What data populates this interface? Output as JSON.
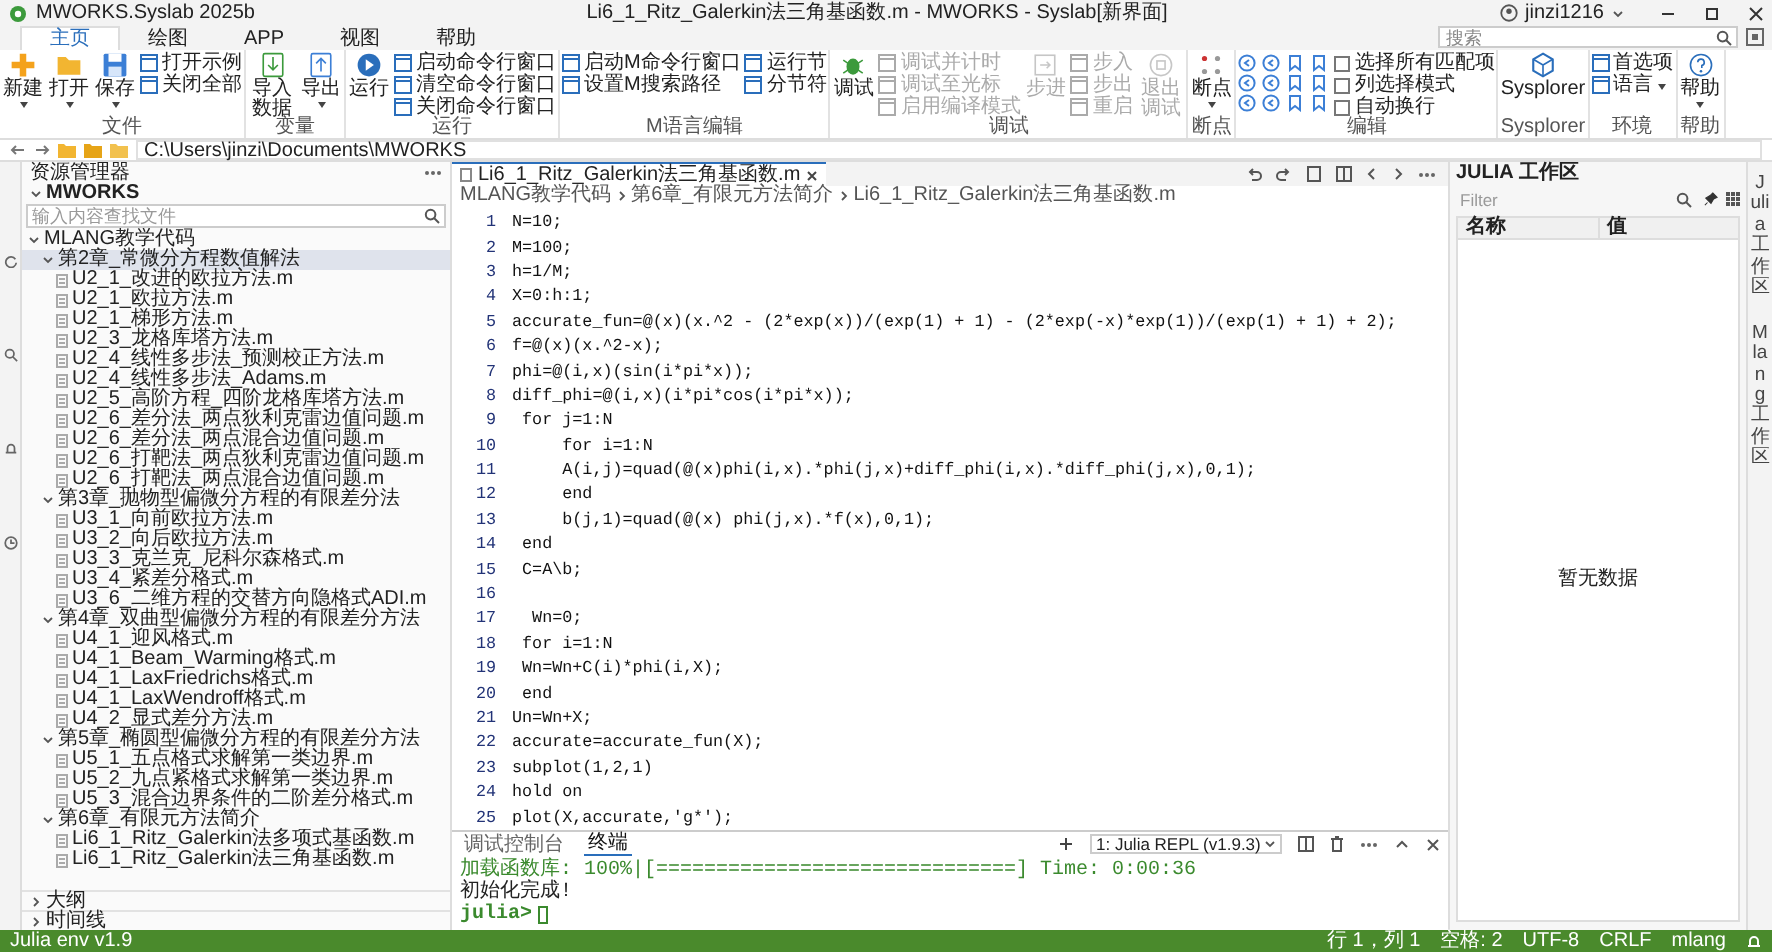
{
  "window": {
    "app_name": "MWORKS.Syslab 2025b",
    "title": "Li6_1_Ritz_Galerkin法三角基函数.m - MWORKS - Syslab[新界面]",
    "user": "jinzi1216"
  },
  "menu_tabs": [
    {
      "label": "主页",
      "selected": true
    },
    {
      "label": "绘图",
      "selected": false
    },
    {
      "label": "APP",
      "selected": false
    },
    {
      "label": "视图",
      "selected": false
    },
    {
      "label": "帮助",
      "selected": false
    }
  ],
  "search": {
    "placeholder": "搜索"
  },
  "ribbon": [
    {
      "label": "文件",
      "items": [
        {
          "kind": "large",
          "label": "新建",
          "dropdown": true,
          "disabled": false
        },
        {
          "kind": "large",
          "label": "打开",
          "dropdown": true,
          "disabled": false
        },
        {
          "kind": "large",
          "label": "保存",
          "dropdown": true,
          "disabled": false
        },
        {
          "kind": "stack",
          "items": [
            {
              "label": "打开示例",
              "dropdown": false,
              "disabled": false
            },
            {
              "label": "关闭全部",
              "dropdown": false,
              "disabled": false
            }
          ]
        }
      ]
    },
    {
      "label": "变量",
      "items": [
        {
          "kind": "large",
          "label": "导入数据",
          "dropdown": false,
          "disabled": false
        },
        {
          "kind": "large",
          "label": "导出",
          "dropdown": true,
          "disabled": false
        }
      ]
    },
    {
      "label": "运行",
      "items": [
        {
          "kind": "large",
          "label": "运行",
          "dropdown": false,
          "disabled": false
        },
        {
          "kind": "stack",
          "items": [
            {
              "label": "启动命令行窗口",
              "dropdown": false,
              "disabled": false
            },
            {
              "label": "清空命令行窗口",
              "dropdown": false,
              "disabled": false
            },
            {
              "label": "关闭命令行窗口",
              "dropdown": false,
              "disabled": false
            }
          ]
        }
      ]
    },
    {
      "label": "M语言编辑",
      "items": [
        {
          "kind": "stack",
          "items": [
            {
              "label": "启动M命令行窗口",
              "dropdown": false,
              "disabled": false
            },
            {
              "label": "设置M搜索路径",
              "dropdown": false,
              "disabled": false
            }
          ]
        },
        {
          "kind": "stack",
          "items": [
            {
              "label": "运行节",
              "dropdown": false,
              "disabled": false
            },
            {
              "label": "分节符",
              "dropdown": false,
              "disabled": false
            }
          ]
        }
      ]
    },
    {
      "label": "调试",
      "items": [
        {
          "kind": "large",
          "label": "调试",
          "dropdown": false,
          "disabled": false
        },
        {
          "kind": "stack",
          "items": [
            {
              "label": "调试并计时",
              "dropdown": false,
              "disabled": true
            },
            {
              "label": "调试至光标",
              "dropdown": false,
              "disabled": true
            },
            {
              "label": "启用编译模式",
              "dropdown": false,
              "disabled": true
            }
          ]
        },
        {
          "kind": "large",
          "label": "步进",
          "dropdown": false,
          "disabled": true
        },
        {
          "kind": "stack",
          "items": [
            {
              "label": "步入",
              "dropdown": false,
              "disabled": true
            },
            {
              "label": "步出",
              "dropdown": false,
              "disabled": true
            },
            {
              "label": "重启",
              "dropdown": false,
              "disabled": true
            }
          ]
        },
        {
          "kind": "large",
          "label": "退出调试",
          "dropdown": false,
          "disabled": true
        }
      ]
    },
    {
      "label": "断点",
      "items": [
        {
          "kind": "large",
          "label": "断点",
          "dropdown": true,
          "disabled": false
        }
      ]
    },
    {
      "label": "编辑",
      "items": [
        {
          "kind": "tools"
        },
        {
          "kind": "checks",
          "items": [
            {
              "label": "选择所有匹配项",
              "checked": false
            },
            {
              "label": "列选择模式",
              "checked": false
            },
            {
              "label": "自动换行",
              "checked": false
            }
          ]
        }
      ]
    },
    {
      "label": "Sysplorer",
      "items": [
        {
          "kind": "large",
          "label": "Sysplorer",
          "dropdown": false,
          "disabled": false
        }
      ]
    },
    {
      "label": "环境",
      "items": [
        {
          "kind": "stack",
          "items": [
            {
              "label": "首选项",
              "dropdown": false,
              "disabled": false
            },
            {
              "label": "语言",
              "dropdown": true,
              "disabled": false
            }
          ]
        }
      ]
    },
    {
      "label": "帮助",
      "items": [
        {
          "kind": "large",
          "label": "帮助",
          "dropdown": true,
          "disabled": false
        }
      ]
    }
  ],
  "path_bar": {
    "path": "C:\\Users\\jinzi\\Documents\\MWORKS"
  },
  "sidebar": {
    "title": "资源管理器",
    "root": "MWORKS",
    "search": {
      "placeholder": "输入内容查找文件"
    },
    "tree": [
      {
        "label": "MLANG教学代码",
        "expanded": true,
        "selected": false,
        "children": [
          {
            "label": "第2章_常微分方程数值解法",
            "expanded": true,
            "selected": true,
            "children": [
              {
                "label": "U2_1_改进的欧拉方法.m",
                "selected": false
              },
              {
                "label": "U2_1_欧拉方法.m",
                "selected": false
              },
              {
                "label": "U2_1_梯形方法.m",
                "selected": false
              },
              {
                "label": "U2_3_龙格库塔方法.m",
                "selected": false
              },
              {
                "label": "U2_4_线性多步法_预测校正方法.m",
                "selected": false
              },
              {
                "label": "U2_4_线性多步法_Adams.m",
                "selected": false
              },
              {
                "label": "U2_5_高阶方程_四阶龙格库塔方法.m",
                "selected": false
              },
              {
                "label": "U2_6_差分法_两点狄利克雷边值问题.m",
                "selected": false
              },
              {
                "label": "U2_6_差分法_两点混合边值问题.m",
                "selected": false
              },
              {
                "label": "U2_6_打靶法_两点狄利克雷边值问题.m",
                "selected": false
              },
              {
                "label": "U2_6_打靶法_两点混合边值问题.m",
                "selected": false
              }
            ]
          },
          {
            "label": "第3章_抛物型偏微分方程的有限差分法",
            "expanded": true,
            "selected": false,
            "children": [
              {
                "label": "U3_1_向前欧拉方法.m",
                "selected": false
              },
              {
                "label": "U3_2_向后欧拉方法.m",
                "selected": false
              },
              {
                "label": "U3_3_克兰克_尼科尔森格式.m",
                "selected": false
              },
              {
                "label": "U3_4_紧差分格式.m",
                "selected": false
              },
              {
                "label": "U3_6_二维方程的交替方向隐格式ADI.m",
                "selected": false
              }
            ]
          },
          {
            "label": "第4章_双曲型偏微分方程的有限差分方法",
            "expanded": true,
            "selected": false,
            "children": [
              {
                "label": "U4_1_迎风格式.m",
                "selected": false
              },
              {
                "label": "U4_1_Beam_Warming格式.m",
                "selected": false
              },
              {
                "label": "U4_1_LaxFriedrichs格式.m",
                "selected": false
              },
              {
                "label": "U4_1_LaxWendroff格式.m",
                "selected": false
              },
              {
                "label": "U4_2_显式差分方法.m",
                "selected": false
              }
            ]
          },
          {
            "label": "第5章_椭圆型偏微分方程的有限差分方法",
            "expanded": true,
            "selected": false,
            "children": [
              {
                "label": "U5_1_五点格式求解第一类边界.m",
                "selected": false
              },
              {
                "label": "U5_2_九点紧格式求解第一类边界.m",
                "selected": false
              },
              {
                "label": "U5_3_混合边界条件的二阶差分格式.m",
                "selected": false
              }
            ]
          },
          {
            "label": "第6章_有限元方法简介",
            "expanded": true,
            "selected": false,
            "children": [
              {
                "label": "Li6_1_Ritz_Galerkin法多项式基函数.m",
                "selected": false
              },
              {
                "label": "Li6_1_Ritz_Galerkin法三角基函数.m",
                "selected": false
              }
            ]
          }
        ]
      }
    ],
    "sections": [
      {
        "label": "大纲",
        "expanded": false
      },
      {
        "label": "时间线",
        "expanded": false
      }
    ]
  },
  "editor": {
    "tab_label": "Li6_1_Ritz_Galerkin法三角基函数.m",
    "breadcrumb": [
      "MLANG教学代码",
      "第6章_有限元方法简介",
      "Li6_1_Ritz_Galerkin法三角基函数.m"
    ],
    "code": [
      {
        "line": "1",
        "text": "N=10;"
      },
      {
        "line": "2",
        "text": "M=100;"
      },
      {
        "line": "3",
        "text": "h=1/M;"
      },
      {
        "line": "4",
        "text": "X=0:h:1;"
      },
      {
        "line": "5",
        "text": "accurate_fun=@(x)(x.^2 - (2*exp(x))/(exp(1) + 1) - (2*exp(-x)*exp(1))/(exp(1) + 1) + 2);"
      },
      {
        "line": "6",
        "text": "f=@(x)(x.^2-x);"
      },
      {
        "line": "7",
        "text": "phi=@(i,x)(sin(i*pi*x));"
      },
      {
        "line": "8",
        "text": "diff_phi=@(i,x)(i*pi*cos(i*pi*x));"
      },
      {
        "line": "9",
        "text": " for j=1:N"
      },
      {
        "line": "10",
        "text": "     for i=1:N"
      },
      {
        "line": "11",
        "text": "     A(i,j)=quad(@(x)phi(i,x).*phi(j,x)+diff_phi(i,x).*diff_phi(j,x),0,1);"
      },
      {
        "line": "12",
        "text": "     end"
      },
      {
        "line": "13",
        "text": "     b(j,1)=quad(@(x) phi(j,x).*f(x),0,1);"
      },
      {
        "line": "14",
        "text": " end"
      },
      {
        "line": "15",
        "text": " C=A\\b;"
      },
      {
        "line": "16"
      },
      {
        "line": "17",
        "text": "  Wn=0;"
      },
      {
        "line": "18",
        "text": " for i=1:N"
      },
      {
        "line": "19",
        "text": " Wn=Wn+C(i)*phi(i,X);"
      },
      {
        "line": "20",
        "text": " end"
      },
      {
        "line": "21",
        "text": "Un=Wn+X;"
      },
      {
        "line": "22",
        "text": "accurate=accurate_fun(X);"
      },
      {
        "line": "23",
        "text": "subplot(1,2,1)"
      },
      {
        "line": "24",
        "text": "hold on"
      },
      {
        "line": "25",
        "text": "plot(X,accurate,'g*');"
      }
    ]
  },
  "panel": {
    "tabs": [
      {
        "label": "调试控制台",
        "selected": false
      },
      {
        "label": "终端",
        "selected": true
      }
    ],
    "terminal_select": "1: Julia REPL (v1.9.3)",
    "output": [
      {
        "kind": "progress",
        "text": "加载函数库: 100%|[==============================] Time: 0:00:36"
      },
      {
        "kind": "plain",
        "text": "初始化完成!"
      },
      {
        "kind": "prompt",
        "text": "julia>"
      }
    ]
  },
  "workspace": {
    "title": "JULIA 工作区",
    "filter": {
      "placeholder": "Filter"
    },
    "columns": [
      "名称",
      "值"
    ],
    "empty_text": "暂无数据"
  },
  "side_tabs": [
    "Julia 工作区",
    "Mlang 工作区"
  ],
  "status_bar": {
    "env": "Julia env v1.9",
    "items": [
      "行 1，列 1",
      "空格: 2",
      "UTF-8",
      "CRLF",
      "mlang"
    ]
  }
}
